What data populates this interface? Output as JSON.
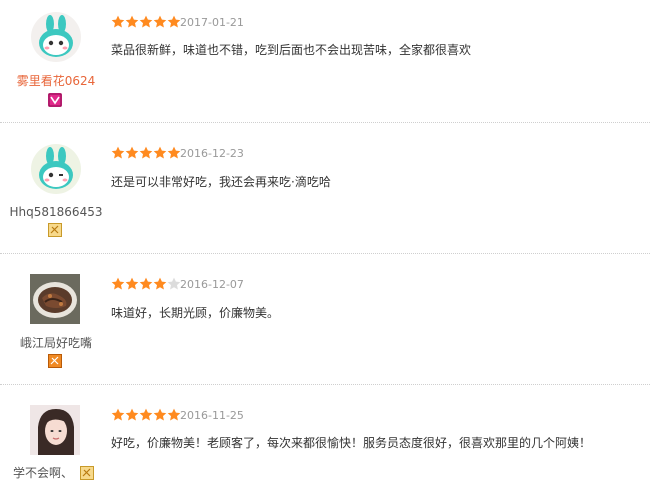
{
  "colors": {
    "star_filled": "#ff8a1f",
    "star_empty": "#dcdcdc",
    "date": "#999999",
    "comment": "#333333",
    "username_highlight": "#e8663a",
    "username_default": "#555555"
  },
  "reviews": [
    {
      "username": "雾里看花0624",
      "username_color": "#e8663a",
      "avatar": "cartoon-bunny-icon",
      "badge": "vip-level-badge-icon",
      "rating": 5,
      "date": "2017-01-21",
      "comment": "菜品很新鲜，味道也不错，吃到后面也不会出现苦味，全家都很喜欢"
    },
    {
      "username": "Hhq581866453",
      "username_color": "#555555",
      "avatar": "cartoon-bunny-icon",
      "badge": "member-level-badge-icon",
      "rating": 5,
      "date": "2016-12-23",
      "comment": "还是可以非常好吃，我还会再来吃·滴吃哈"
    },
    {
      "username": "峨江局好吃嘴",
      "username_color": "#555555",
      "avatar": "food-photo-avatar",
      "badge": "orange-level-badge-icon",
      "rating": 4,
      "date": "2016-12-07",
      "comment": "味道好，长期光顾，价廉物美。"
    },
    {
      "username": "学不会啊、",
      "username_color": "#555555",
      "avatar": "user-photo-avatar",
      "badge": "member-level-badge-icon",
      "rating": 5,
      "date": "2016-11-25",
      "comment": "好吃，价廉物美！老顾客了，每次来都很愉快！服务员态度很好，很喜欢那里的几个阿姨！"
    }
  ]
}
